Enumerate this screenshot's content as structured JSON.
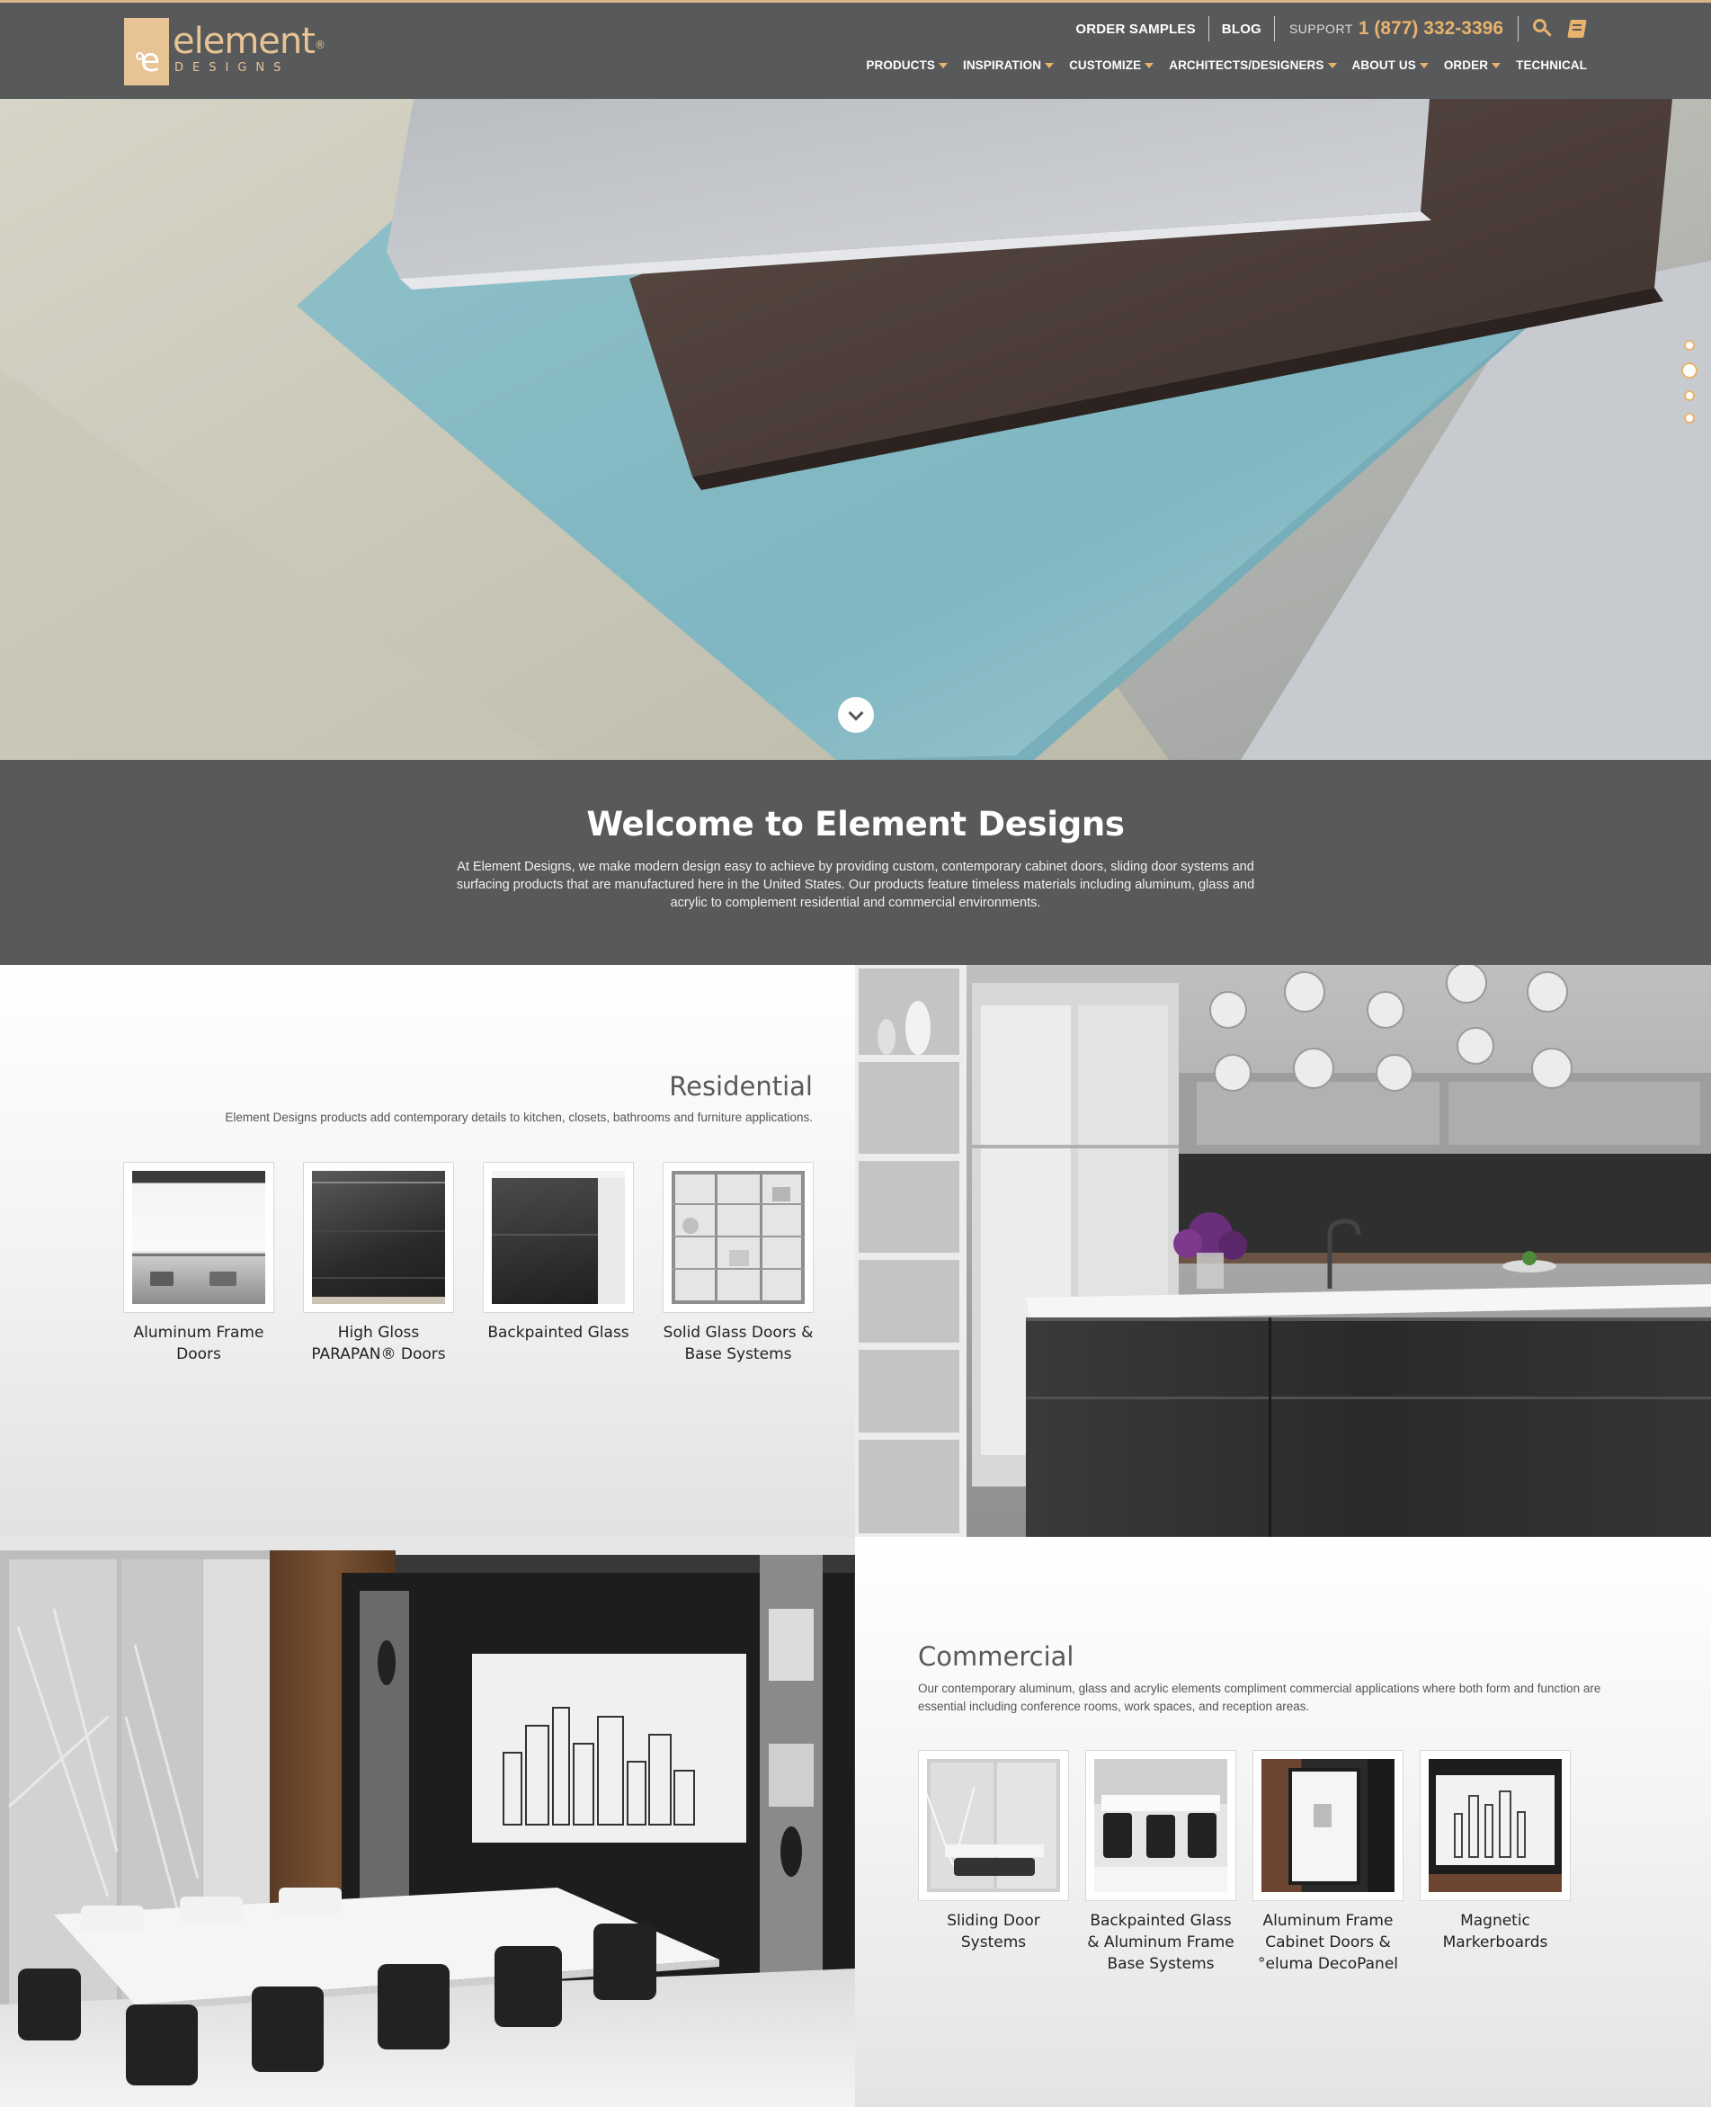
{
  "brand": {
    "logo_word": "element",
    "logo_sub": "DESIGNS"
  },
  "topbar": {
    "order_samples": "ORDER SAMPLES",
    "blog": "BLOG",
    "support_label": "SUPPORT",
    "phone": "1 (877) 332-3396"
  },
  "nav": {
    "items": [
      {
        "label": "PRODUCTS",
        "dropdown": true
      },
      {
        "label": "INSPIRATION",
        "dropdown": true
      },
      {
        "label": "CUSTOMIZE",
        "dropdown": true
      },
      {
        "label": "ARCHITECTS/DESIGNERS",
        "dropdown": true
      },
      {
        "label": "ABOUT US",
        "dropdown": true
      },
      {
        "label": "ORDER",
        "dropdown": true
      },
      {
        "label": "TECHNICAL",
        "dropdown": false
      }
    ]
  },
  "hero": {
    "slide_count": 4,
    "active_slide": 2
  },
  "welcome": {
    "title": "Welcome to Element Designs",
    "text": "At Element Designs, we make modern design easy to achieve by providing custom, contemporary cabinet doors, sliding door systems and surfacing products that are manufactured here in the United States. Our products feature timeless materials including aluminum, glass and acrylic to complement residential and commercial environments."
  },
  "residential": {
    "title": "Residential",
    "description": "Element Designs products add contemporary details to kitchen, closets, bathrooms and furniture applications.",
    "items": [
      {
        "label": "Aluminum Frame Doors"
      },
      {
        "label": "High Gloss PARAPAN® Doors"
      },
      {
        "label": "Backpainted Glass"
      },
      {
        "label": "Solid Glass Doors & Base Systems"
      }
    ]
  },
  "commercial": {
    "title": "Commercial",
    "description": "Our contemporary aluminum, glass and acrylic elements compliment commercial applications where both form and function are essential including conference rooms, work spaces, and reception areas.",
    "items": [
      {
        "label": "Sliding Door Systems"
      },
      {
        "label": "Backpainted Glass & Aluminum Frame Base Systems"
      },
      {
        "label": "Aluminum Frame Cabinet Doors & °eluma DecoPanel"
      },
      {
        "label": "Magnetic Markerboards"
      }
    ]
  },
  "colors": {
    "header_bg": "#58595b",
    "accent": "#e8b36c",
    "logo": "#e8c394"
  }
}
